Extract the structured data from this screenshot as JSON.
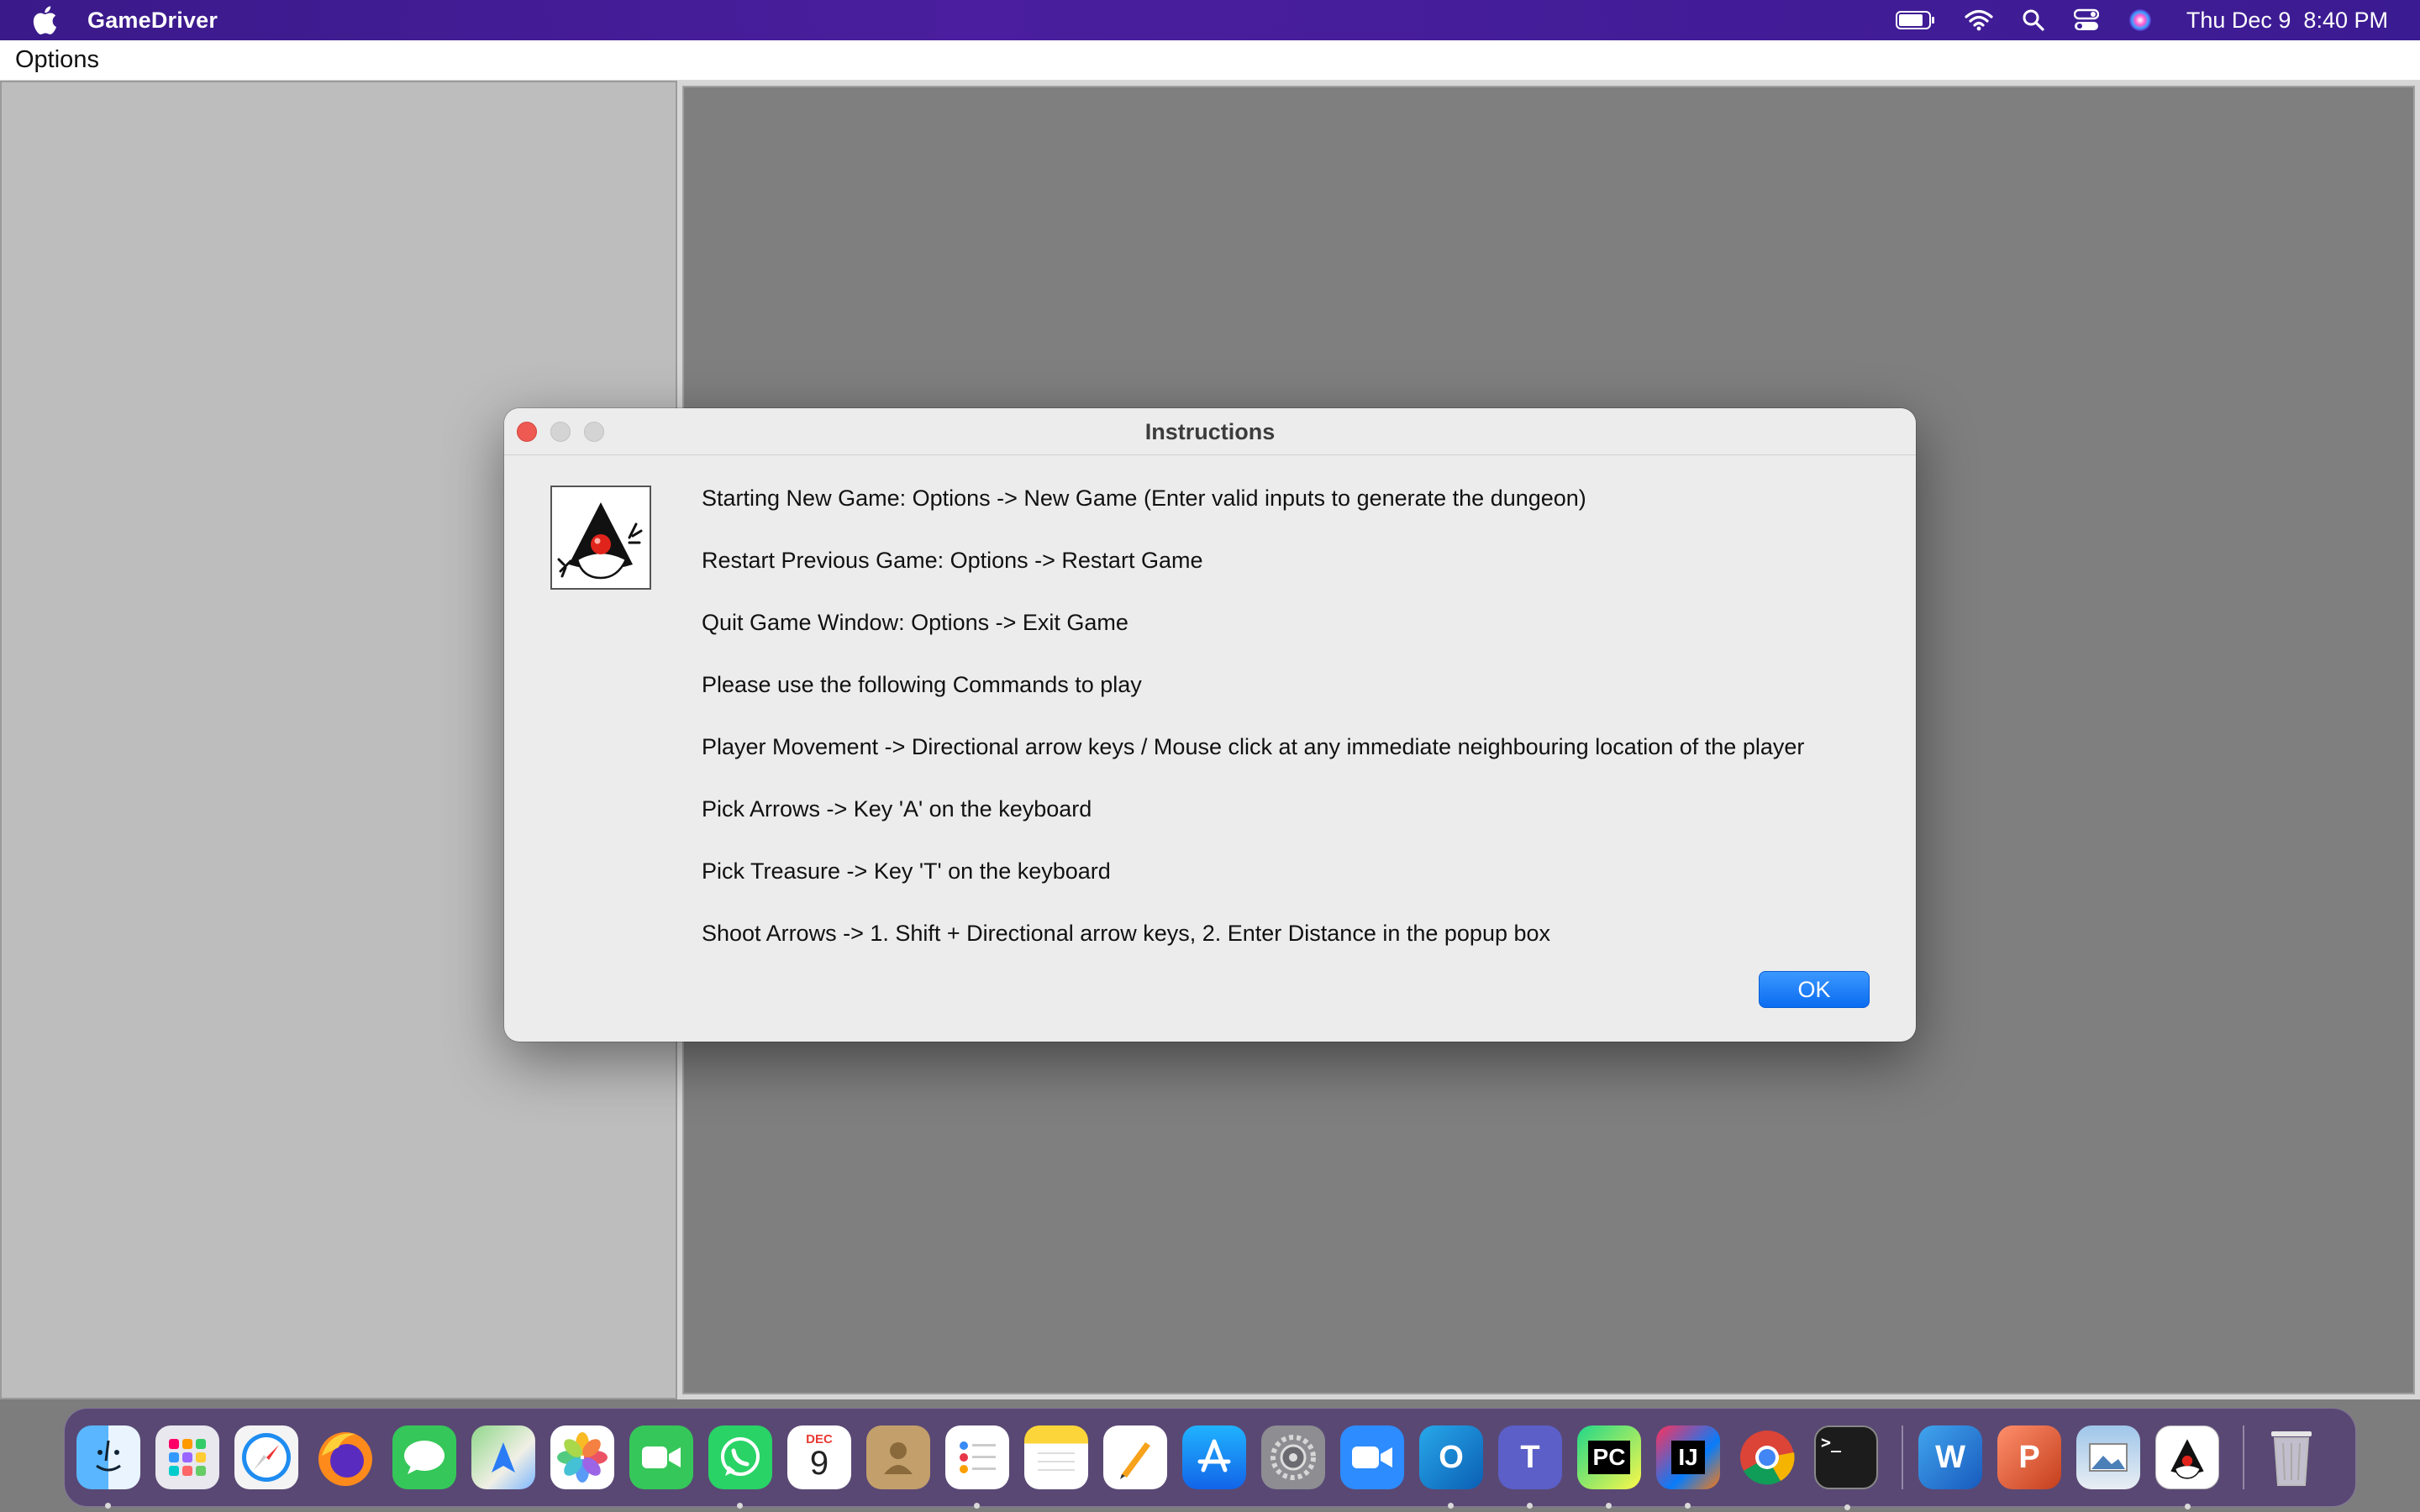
{
  "menubar": {
    "app_name": "GameDriver",
    "clock": "Thu Dec 9  8:40 PM",
    "status_icons": [
      "battery-icon",
      "wifi-icon",
      "spotlight-search-icon",
      "control-center-icon",
      "siri-icon"
    ]
  },
  "app": {
    "menu": {
      "options_label": "Options"
    }
  },
  "dialog": {
    "title": "Instructions",
    "icon": "java-duke-icon",
    "lines": [
      "Starting New Game: Options -> New Game (Enter valid inputs to generate the dungeon)",
      "Restart Previous Game: Options -> Restart Game",
      "Quit Game Window: Options -> Exit Game",
      "Please use the following Commands to play",
      "Player Movement -> Directional arrow keys / Mouse click at any immediate neighbouring location of the player",
      "Pick Arrows -> Key 'A' on the keyboard",
      "Pick Treasure -> Key 'T' on the keyboard",
      "Shoot Arrows -> 1. Shift + Directional arrow keys, 2. Enter Distance in the popup box"
    ],
    "ok_label": "OK"
  },
  "dock": {
    "calendar_month": "DEC",
    "calendar_day": "9",
    "pycharm_label": "PC",
    "intellij_label": "IJ",
    "terminal_label": ">_",
    "word_label": "W",
    "powerpoint_label": "P",
    "outlook_label": "O",
    "teams_label": "T",
    "items": [
      "finder-icon",
      "launchpad-icon",
      "safari-icon",
      "firefox-icon",
      "messages-icon",
      "maps-icon",
      "photos-icon",
      "facetime-icon",
      "whatsapp-icon",
      "calendar-icon",
      "contacts-icon",
      "reminders-icon",
      "notes-icon",
      "pages-icon",
      "app-store-icon",
      "system-preferences-icon",
      "zoom-icon",
      "outlook-icon",
      "teams-icon",
      "pycharm-icon",
      "intellij-icon",
      "chrome-icon",
      "terminal-icon",
      "word-icon",
      "powerpoint-icon",
      "preview-icon",
      "java-app-icon",
      "trash-icon"
    ]
  }
}
